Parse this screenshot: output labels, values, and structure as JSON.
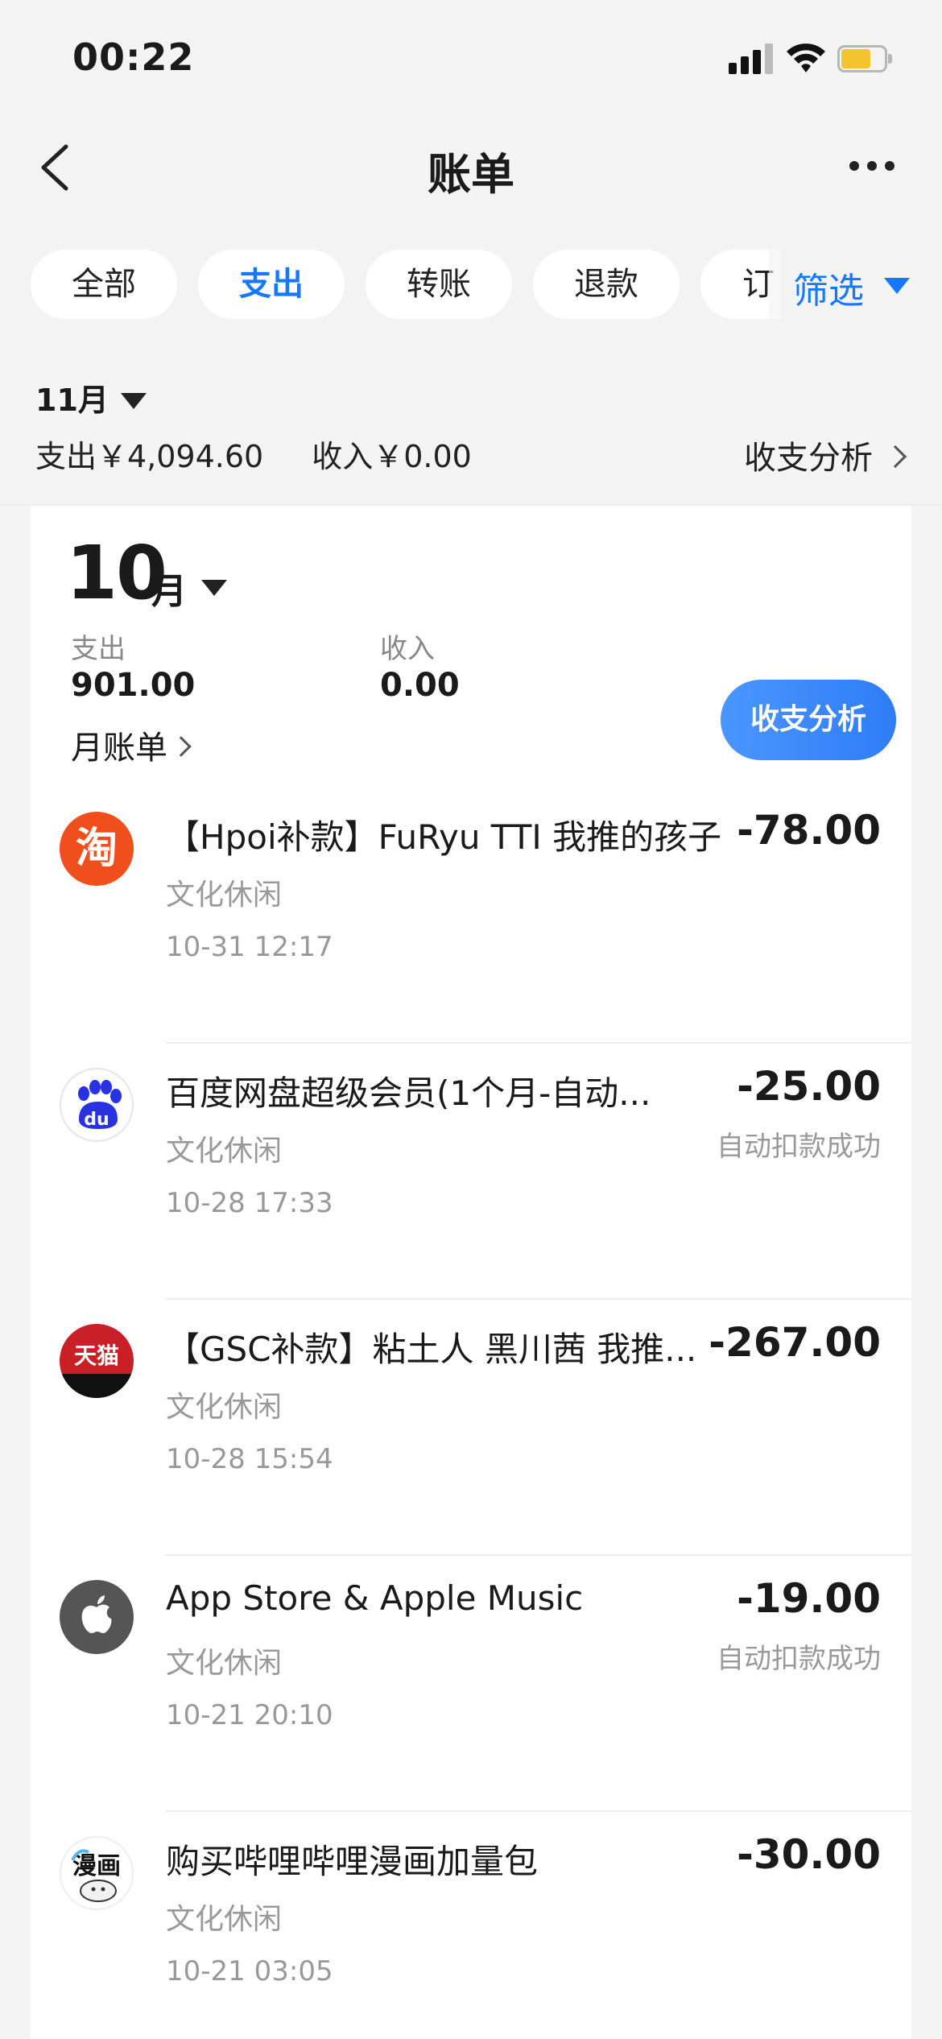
{
  "status_bar": {
    "time": "00:22"
  },
  "nav": {
    "title": "账单"
  },
  "tabs": [
    "全部",
    "支出",
    "转账",
    "退款",
    "订"
  ],
  "active_tab": "支出",
  "filter": {
    "label": "筛选"
  },
  "summary": {
    "month": "11月",
    "expense": "支出￥4,094.60",
    "income": "收入￥0.00",
    "analysis": "收支分析"
  },
  "october": {
    "month_number": "10",
    "month_unit": "月",
    "expense_label": "支出",
    "expense_value": "901.00",
    "income_label": "收入",
    "income_value": "0.00",
    "monthly_bill": "月账单",
    "analysis_button": "收支分析"
  },
  "transactions": [
    {
      "icon": "taobao-icon",
      "icon_text": "淘",
      "title": "【Hpoi补款】FuRyu TTI 我推的孩子 ...",
      "category": "文化休闲",
      "time": "10-31 12:17",
      "amount": "-78.00",
      "note": ""
    },
    {
      "icon": "baidu-netdisk-icon",
      "icon_text": "du",
      "title": "百度网盘超级会员(1个月-自动...",
      "category": "文化休闲",
      "time": "10-28 17:33",
      "amount": "-25.00",
      "note": "自动扣款成功"
    },
    {
      "icon": "tmall-icon",
      "icon_text": "天猫",
      "title": "【GSC补款】粘土人 黑川茜 我推...",
      "category": "文化休闲",
      "time": "10-28 15:54",
      "amount": "-267.00",
      "note": ""
    },
    {
      "icon": "apple-icon",
      "icon_text": "",
      "title": "App Store & Apple Music",
      "category": "文化休闲",
      "time": "10-21 20:10",
      "amount": "-19.00",
      "note": "自动扣款成功"
    },
    {
      "icon": "bilibili-manga-icon",
      "icon_text": "漫画",
      "title": "购买哔哩哔哩漫画加量包",
      "category": "文化休闲",
      "time": "10-21 03:05",
      "amount": "-30.00",
      "note": ""
    }
  ],
  "colors": {
    "accent": "#1677ff",
    "background": "#f4f4f4",
    "taobao": "#f04e1d",
    "tmall": "#c91f26",
    "battery": "#f4c430"
  }
}
